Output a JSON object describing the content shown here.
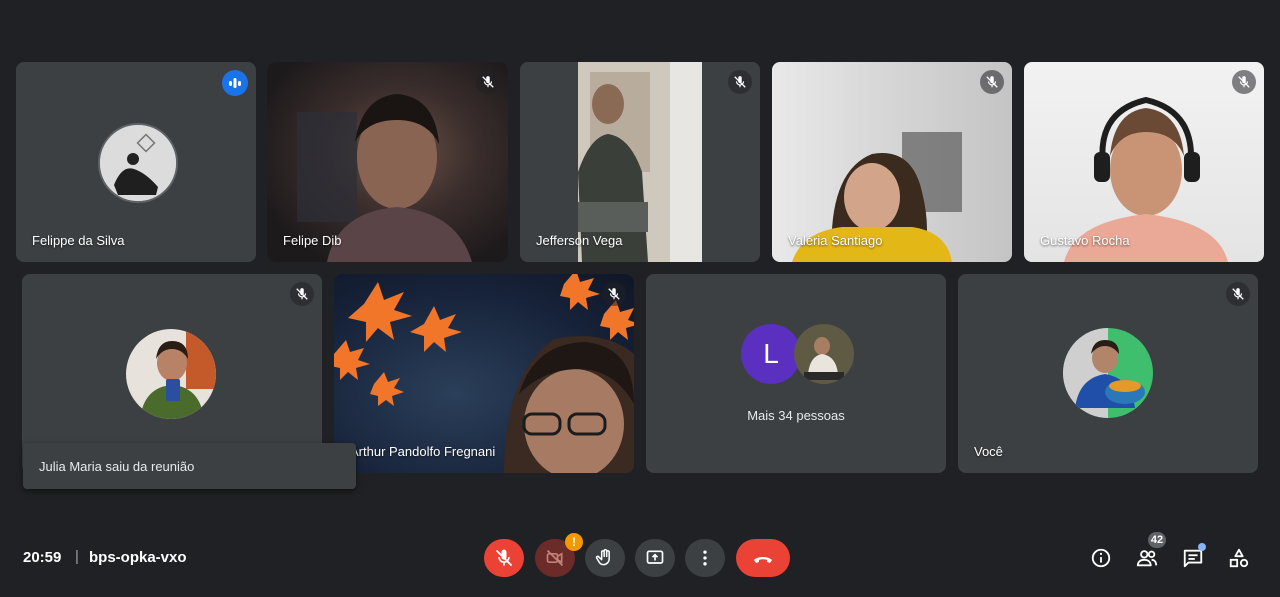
{
  "participants": [
    {
      "name": "Felippe da Silva",
      "status": "speaking"
    },
    {
      "name": "Felipe Dib",
      "status": "muted"
    },
    {
      "name": "Jefferson Vega",
      "status": "muted"
    },
    {
      "name": "Valéria Santiago",
      "status": "muted"
    },
    {
      "name": "Gustavo Rocha",
      "status": "muted"
    },
    {
      "name": "",
      "status": "muted"
    },
    {
      "name": "Arthur Pandolfo Fregnani",
      "status": "muted"
    },
    {
      "name": "Mais 34 pessoas",
      "status": ""
    },
    {
      "name": "Você",
      "status": "muted"
    }
  ],
  "others_tile": {
    "avatar_letter": "L",
    "label": "Mais 34 pessoas"
  },
  "toast": {
    "text": "Julia Maria saiu da reunião"
  },
  "meeting": {
    "time": "20:59",
    "separator": "|",
    "code": "bps-opka-vxo"
  },
  "controls": [
    {
      "icon": "mic-off-icon",
      "state": "off"
    },
    {
      "icon": "camera-off-icon",
      "state": "off",
      "warning": "!"
    },
    {
      "icon": "raise-hand-icon"
    },
    {
      "icon": "present-screen-icon"
    },
    {
      "icon": "more-options-icon"
    },
    {
      "icon": "end-call-icon"
    }
  ],
  "right_controls": {
    "people_count": "42",
    "icons": [
      "info-icon",
      "people-icon",
      "chat-icon",
      "activities-icon"
    ]
  },
  "colors": {
    "background": "#202124",
    "tile": "#3c4043",
    "speaking": "#1a73e8",
    "danger": "#ea4335",
    "avatar_l": "#5b2fc0"
  }
}
